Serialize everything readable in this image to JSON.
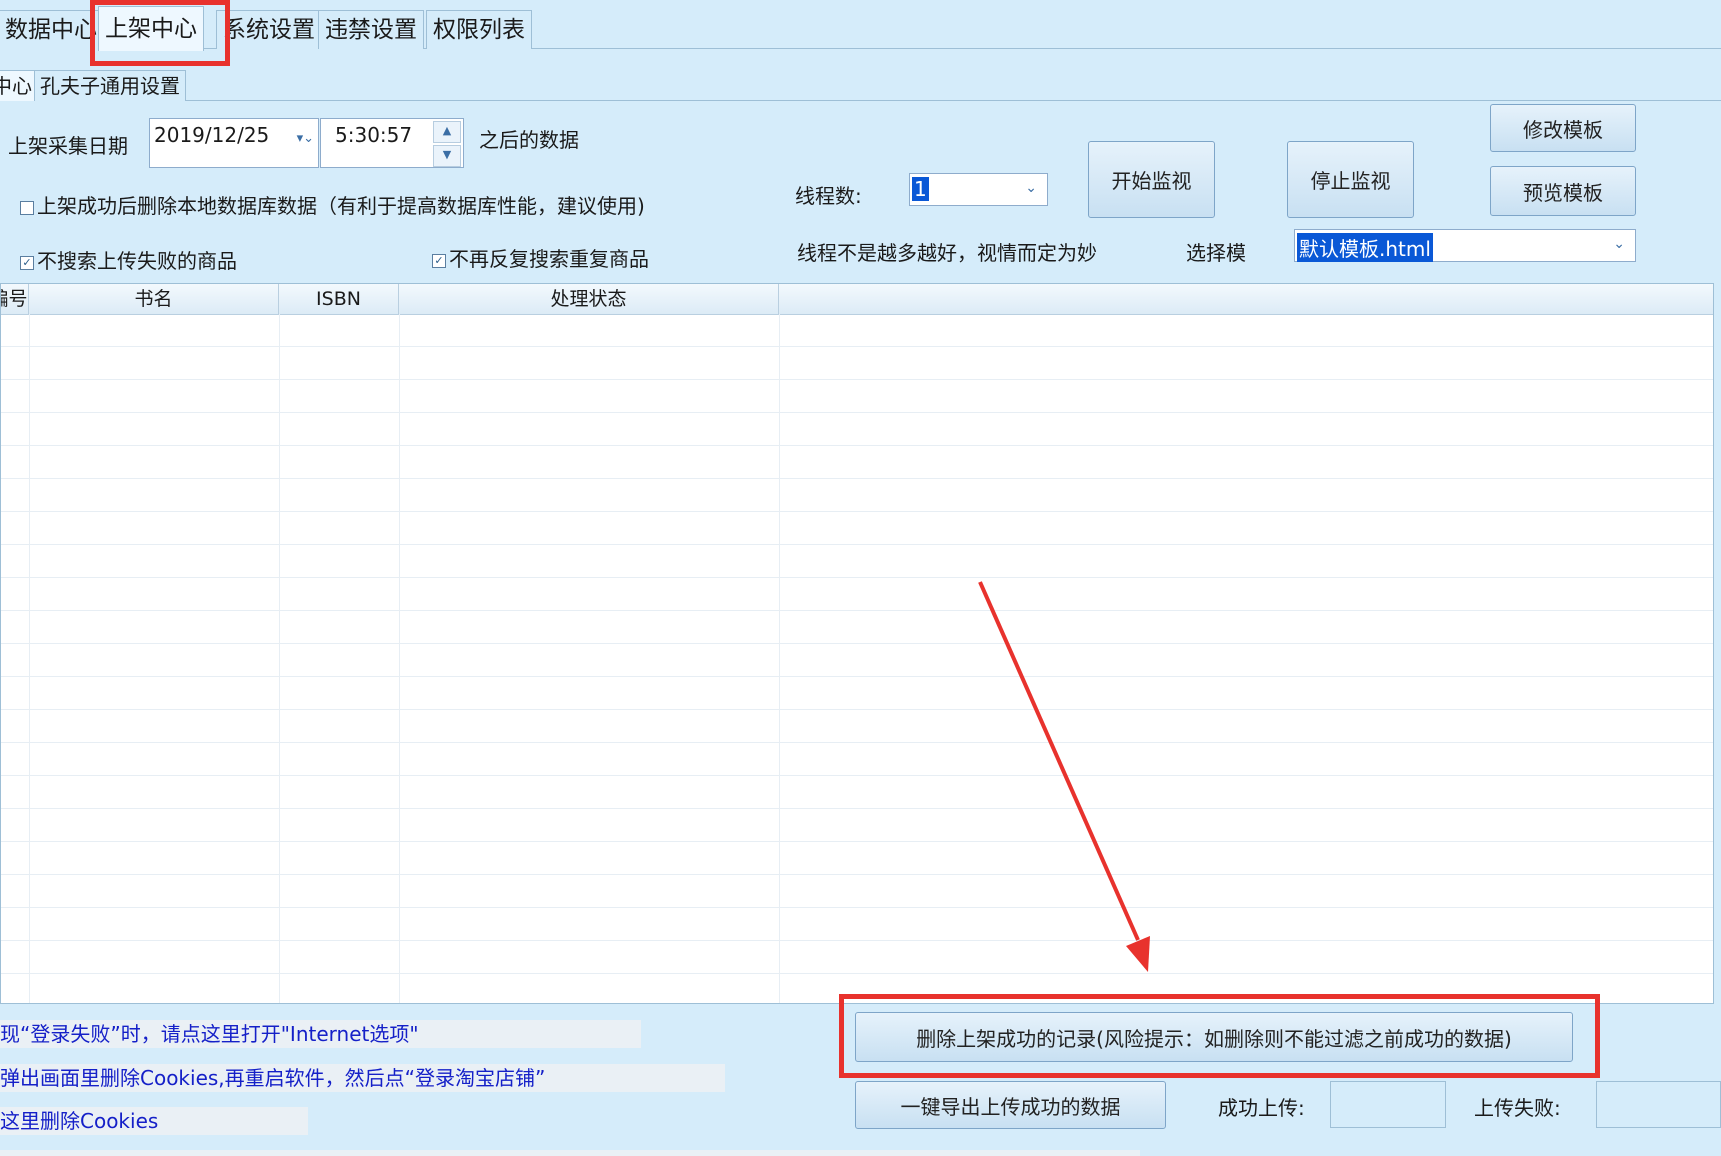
{
  "main_tabs": [
    "数据中心",
    "上架中心",
    "系统设置",
    "违禁设置",
    "权限列表"
  ],
  "sub_tabs": [
    "中心",
    "孔夫子通用设置"
  ],
  "form": {
    "date_label": "上架采集日期",
    "date_value": "2019/12/25",
    "time_value": "5:30:57",
    "after_label": "之后的数据",
    "delete_local_label": "上架成功后删除本地数据库数据（有利于提高数据库性能，建议使用)",
    "skip_failed_label": "不搜索上传失败的商品",
    "skip_duplicate_label": "不再反复搜索重复商品",
    "thread_label": "线程数:",
    "thread_value": "1",
    "thread_tip": "线程不是越多越好，视情而定为妙",
    "template_label": "选择模",
    "template_value": "默认模板.html"
  },
  "buttons": {
    "start_monitor": "开始监视",
    "stop_monitor": "停止监视",
    "edit_template": "修改模板",
    "preview_template": "预览模板",
    "delete_success": "删除上架成功的记录(风险提示：如删除则不能过滤之前成功的数据)",
    "export_success": "一键导出上传成功的数据"
  },
  "grid": {
    "columns": [
      "编号",
      "书名",
      "ISBN",
      "处理状态",
      ""
    ]
  },
  "hints": {
    "login_failed": "现“登录失败”时，请点这里打开\"Internet选项\"",
    "delete_cookies": "弹出画面里删除Cookies,再重启软件，然后点“登录淘宝店铺”",
    "here_delete": "这里删除Cookies"
  },
  "counts": {
    "success_label": "成功上传:",
    "failed_label": "上传失败:"
  },
  "colors": {
    "background": "#d5ecfa",
    "highlight_red": "#e8322d",
    "hint_blue": "#1520c8"
  }
}
